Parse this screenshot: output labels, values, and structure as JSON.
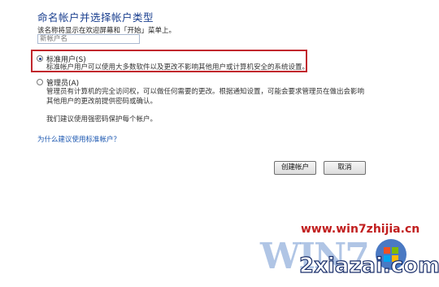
{
  "dialog": {
    "heading": "命名帐户并选择帐户类型",
    "hint": "该名称将显示在欢迎屏幕和「开始」菜单上。",
    "name_input_placeholder": "新帐户名"
  },
  "options": {
    "standard": {
      "label": "标准用户(S)",
      "selected": true,
      "description": "标准帐户用户可以使用大多数软件以及更改不影响其他用户或计算机安全的系统设置。"
    },
    "admin": {
      "label": "管理员(A)",
      "selected": false,
      "description_line1": "管理员有计算机的完全访问权，可以做任何需要的更改。根据通知设置，可能会要求管理员在做出会影响",
      "description_line2": "其他用户的更改前提供密码或确认。",
      "recommendation": "我们建议使用强密码保护每个帐户。"
    }
  },
  "help_link": "为什么建议使用标准帐户？",
  "buttons": {
    "create": "创建帐户",
    "cancel": "取消"
  },
  "watermark": {
    "url": "www.win7zhijia.cn",
    "logo_text": "WIN7",
    "site": "2xiazai.com"
  },
  "colors": {
    "heading": "#1a3f8f",
    "highlight_border": "#c1272d",
    "link": "#1a56b0",
    "watermark_url": "#c11f1f"
  }
}
